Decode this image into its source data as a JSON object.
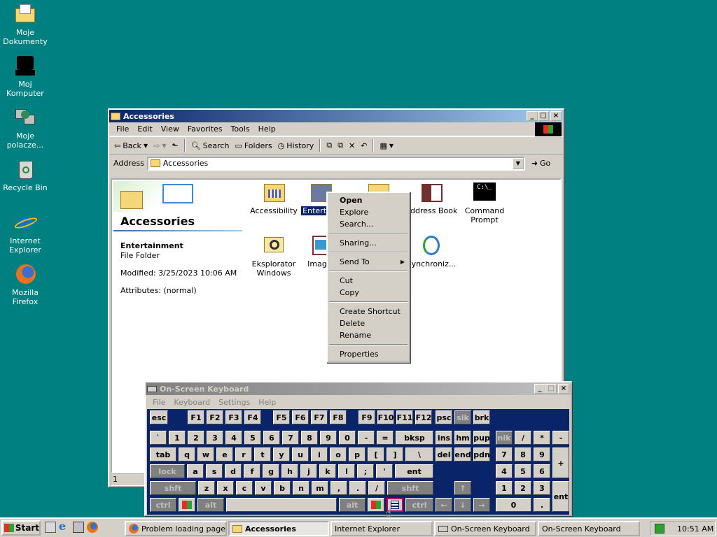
{
  "desktop": {
    "icons": [
      {
        "label": "Moje Dokumenty",
        "icon": "my-documents-icon"
      },
      {
        "label": "Moj Komputer",
        "icon": "my-computer-icon"
      },
      {
        "label": "Moje polacze...",
        "icon": "network-places-icon"
      },
      {
        "label": "Recycle Bin",
        "icon": "recycle-bin-icon"
      },
      {
        "label": "Internet Explorer",
        "icon": "internet-explorer-icon"
      },
      {
        "label": "Mozilla Firefox",
        "icon": "firefox-icon"
      }
    ]
  },
  "explorer": {
    "title": "Accessories",
    "menu": [
      "File",
      "Edit",
      "View",
      "Favorites",
      "Tools",
      "Help"
    ],
    "toolbar": {
      "back": "Back",
      "search": "Search",
      "folders": "Folders",
      "history": "History"
    },
    "address_label": "Address",
    "address_value": "Accessories",
    "go_label": "Go",
    "panel": {
      "heading": "Accessories",
      "selected_name": "Entertainment",
      "selected_type": "File Folder",
      "modified": "Modified: 3/25/2023 10:06 AM",
      "attributes": "Attributes: (normal)"
    },
    "items": [
      {
        "label": "Accessibility",
        "icon": "folder-icon"
      },
      {
        "label": "Entertai",
        "icon": "folder-icon"
      },
      {
        "label": "",
        "icon": "folder-icon"
      },
      {
        "label": "Address Book",
        "icon": "address-book-icon"
      },
      {
        "label": "Command Prompt",
        "icon": "command-prompt-icon"
      },
      {
        "label": "Eksplorator Windows",
        "icon": "explorer-icon"
      },
      {
        "label": "Imag",
        "icon": "imaging-icon"
      },
      {
        "label": "Synchroniz...",
        "icon": "synchronize-icon"
      }
    ],
    "status": "1 object(s"
  },
  "context_menu": {
    "items": [
      "Open",
      "Explore",
      "Search...",
      "Sharing...",
      "Send To",
      "Cut",
      "Copy",
      "Create Shortcut",
      "Delete",
      "Rename",
      "Properties"
    ]
  },
  "osk": {
    "title": "On-Screen Keyboard",
    "menu": [
      "File",
      "Keyboard",
      "Settings",
      "Help"
    ],
    "rows": {
      "r0": [
        "esc",
        "F1",
        "F2",
        "F3",
        "F4",
        "F5",
        "F6",
        "F7",
        "F8",
        "F9",
        "F10",
        "F11",
        "F12",
        "psc",
        "slk",
        "brk"
      ],
      "r1": [
        "`",
        "1",
        "2",
        "3",
        "4",
        "5",
        "6",
        "7",
        "8",
        "9",
        "0",
        "-",
        "=",
        "bksp",
        "ins",
        "hm",
        "pup",
        "nlk",
        "/",
        "*",
        "-"
      ],
      "r2": [
        "tab",
        "q",
        "w",
        "e",
        "r",
        "t",
        "y",
        "u",
        "i",
        "o",
        "p",
        "[",
        "]",
        "\\",
        "del",
        "end",
        "pdn",
        "7",
        "8",
        "9",
        "+"
      ],
      "r3": [
        "lock",
        "a",
        "s",
        "d",
        "f",
        "g",
        "h",
        "j",
        "k",
        "l",
        ";",
        "'",
        "ent",
        "4",
        "5",
        "6"
      ],
      "r4": [
        "shft",
        "z",
        "x",
        "c",
        "v",
        "b",
        "n",
        "m",
        ",",
        ".",
        "/",
        "shft",
        "↑",
        "1",
        "2",
        "3",
        "ent"
      ],
      "r5": [
        "ctrl",
        "",
        "alt",
        "",
        "alt",
        "",
        "",
        "ctrl",
        "←",
        "↓",
        "→",
        "0",
        "."
      ]
    }
  },
  "taskbar": {
    "start": "Start",
    "tasks": [
      "Problem loading page -...",
      "Accessories",
      "Internet Explorer",
      "On-Screen Keyboard",
      "On-Screen Keyboard"
    ],
    "clock": "10:51 AM"
  },
  "colors": {
    "desktop": "#008080",
    "titlebar": "#0a246a",
    "osk_bg": "#0a246a"
  }
}
